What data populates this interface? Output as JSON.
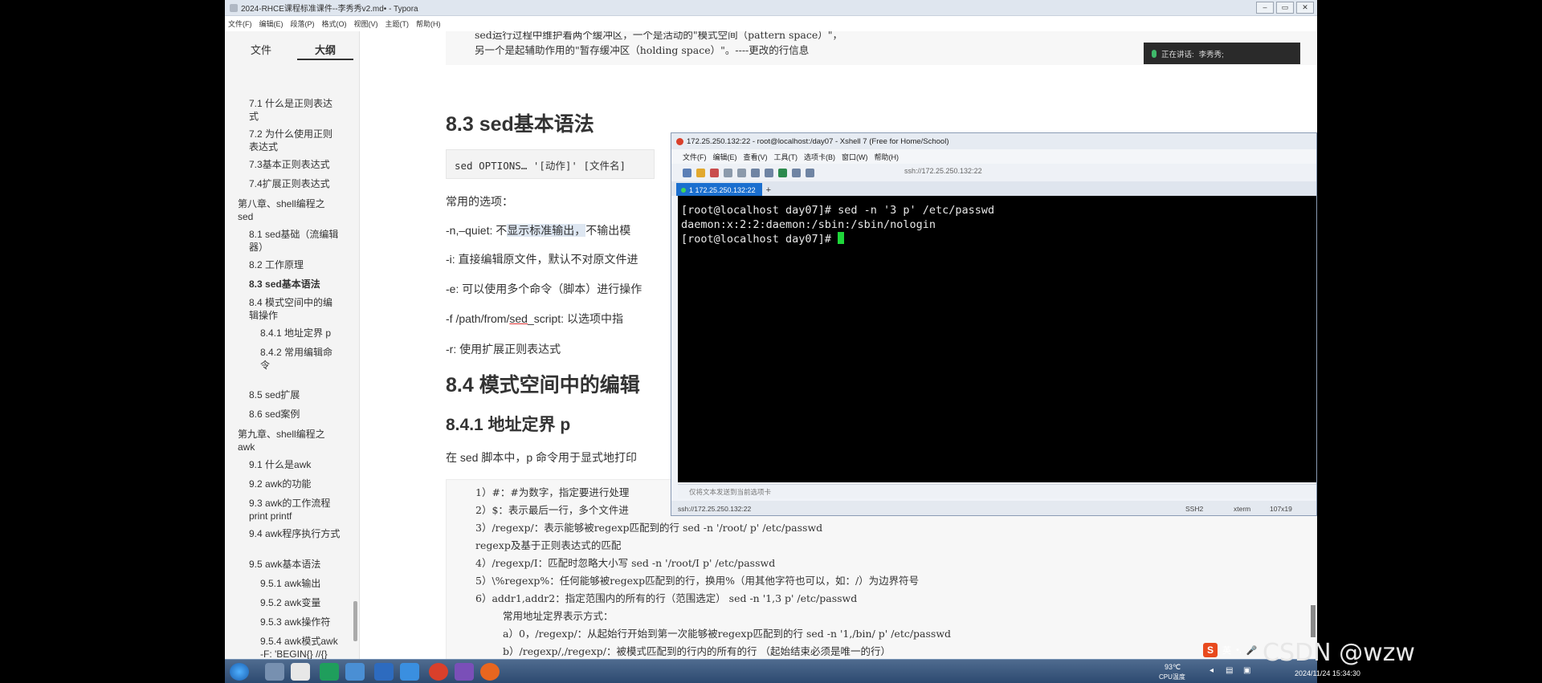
{
  "typora": {
    "title": "2024-RHCE课程标准课件--李秀秀v2.md• - Typora",
    "menu": [
      "文件(F)",
      "编辑(E)",
      "段落(P)",
      "格式(O)",
      "视图(V)",
      "主题(T)",
      "帮助(H)"
    ],
    "window_buttons": [
      "–",
      "▭",
      "✕"
    ],
    "sidebar_tabs": {
      "files": "文件",
      "outline": "大纲"
    },
    "outline": [
      "7.1 什么是正则表达式",
      "7.2 为什么使用正则表达式",
      "7.3基本正则表达式",
      "7.4扩展正则表达式",
      "第八章、shell编程之sed",
      "8.1 sed基础（流编辑器）",
      "8.2 工作原理",
      "8.3 sed基本语法",
      "8.4 模式空间中的编辑操作",
      "8.4.1 地址定界 p",
      "8.4.2 常用编辑命令",
      "8.5 sed扩展",
      "8.6 sed案例",
      "第九章、shell编程之awk",
      "9.1 什么是awk",
      "9.2 awk的功能",
      "9.3 awk的工作流程print printf",
      "9.4 awk程序执行方式",
      "9.5 awk基本语法",
      "9.5.1 awk输出",
      "9.5.2 awk变量",
      "9.5.3 awk操作符",
      "9.5.4 awk模式awk -F: 'BEGIN{} //{} END{}' filename"
    ],
    "sidebar_footer": {
      "back": "‹",
      "source": "</>"
    }
  },
  "document": {
    "top_line1": "sed运行过程中维护着两个缓冲区，一个是活动的\"模式空间（pattern space）\"，",
    "top_line2": "另一个是起辅助作用的\"暂存缓冲区（holding space）\"。----更改的行信息",
    "h_83": "8.3 sed基本语法",
    "syntax_code": "sed OPTIONS… '[动作]' [文件名]",
    "options_title": "常用的选项：",
    "opt_n_a": "-n,–quiet: 不",
    "opt_n_hl": "显示标准输出，",
    "opt_n_b": "不输出模",
    "opt_i": "-i: 直接编辑原文件，默认不对原文件进",
    "opt_e": "-e: 可以使用多个命令（脚本）进行操作",
    "opt_f_a": "-f /path/from/",
    "opt_f_b": "sed",
    "opt_f_c": "_script: 以选项中指",
    "opt_r": "-r: 使用扩展正则表达式",
    "h_84": "8.4 模式空间中的编辑",
    "h_841": "8.4.1 地址定界  p",
    "p_sed": "在 sed 脚本中，p 命令用于显式地打印",
    "block_lines": [
      "1）#：#为数字，指定要进行处理",
      "2）$：表示最后一行，多个文件进",
      "3）/regexp/：表示能够被regexp匹配到的行   sed -n '/root/ p' /etc/passwd",
      "regexp及基于正则表达式的匹配",
      "4）/regexp/I：匹配时忽略大小写      sed -n '/root/I p' /etc/passwd",
      "5）\\%regexp%：任何能够被regexp匹配到的行，换用%（用其他字符也可以，如：/）为边界符号",
      "6）addr1,addr2：指定范围内的所有的行（范围选定）  sed -n '1,3 p' /etc/passwd",
      "常用地址定界表示方式：",
      "a）0，/regexp/：从起始行开始到第一次能够被regexp匹配到的行   sed -n '1,/bin/ p' /etc/passwd",
      "b）/regexp/,/regexp/：被模式匹配到的行内的所有的行   （起始结束必须是唯一的行）"
    ]
  },
  "meeting": {
    "speaking_label": "正在讲话:",
    "speaker": "李秀秀;"
  },
  "xshell": {
    "title": "172.25.250.132:22 - root@localhost:/day07 - Xshell 7 (Free for Home/School)",
    "menu": [
      "文件(F)",
      "编辑(E)",
      "查看(V)",
      "工具(T)",
      "选项卡(B)",
      "窗口(W)",
      "帮助(H)"
    ],
    "address": "ssh://172.25.250.132:22",
    "tab_label": "1 172.25.250.132:22",
    "tab_add": "+",
    "terminal_lines": [
      "[root@localhost day07]# sed -n '3 p' /etc/passwd",
      "daemon:x:2:2:daemon:/sbin:/sbin/nologin",
      "[root@localhost day07]# "
    ],
    "input_hint": "仅将文本发送到当前选项卡",
    "status": {
      "host": "ssh://172.25.250.132:22",
      "proto": "SSH2",
      "term": "xterm",
      "size": "107x19"
    }
  },
  "taskbar": {
    "ime_lang": "英",
    "weather_temp": "93℃",
    "weather_label": "CPU温度",
    "datetime": "2024/11/24 15:34:30"
  },
  "watermark": "CSDN @wzw",
  "colors": {
    "terminal_bg": "#000000",
    "cursor": "#1fd63a",
    "xshell_tab": "#1b6fcf"
  }
}
